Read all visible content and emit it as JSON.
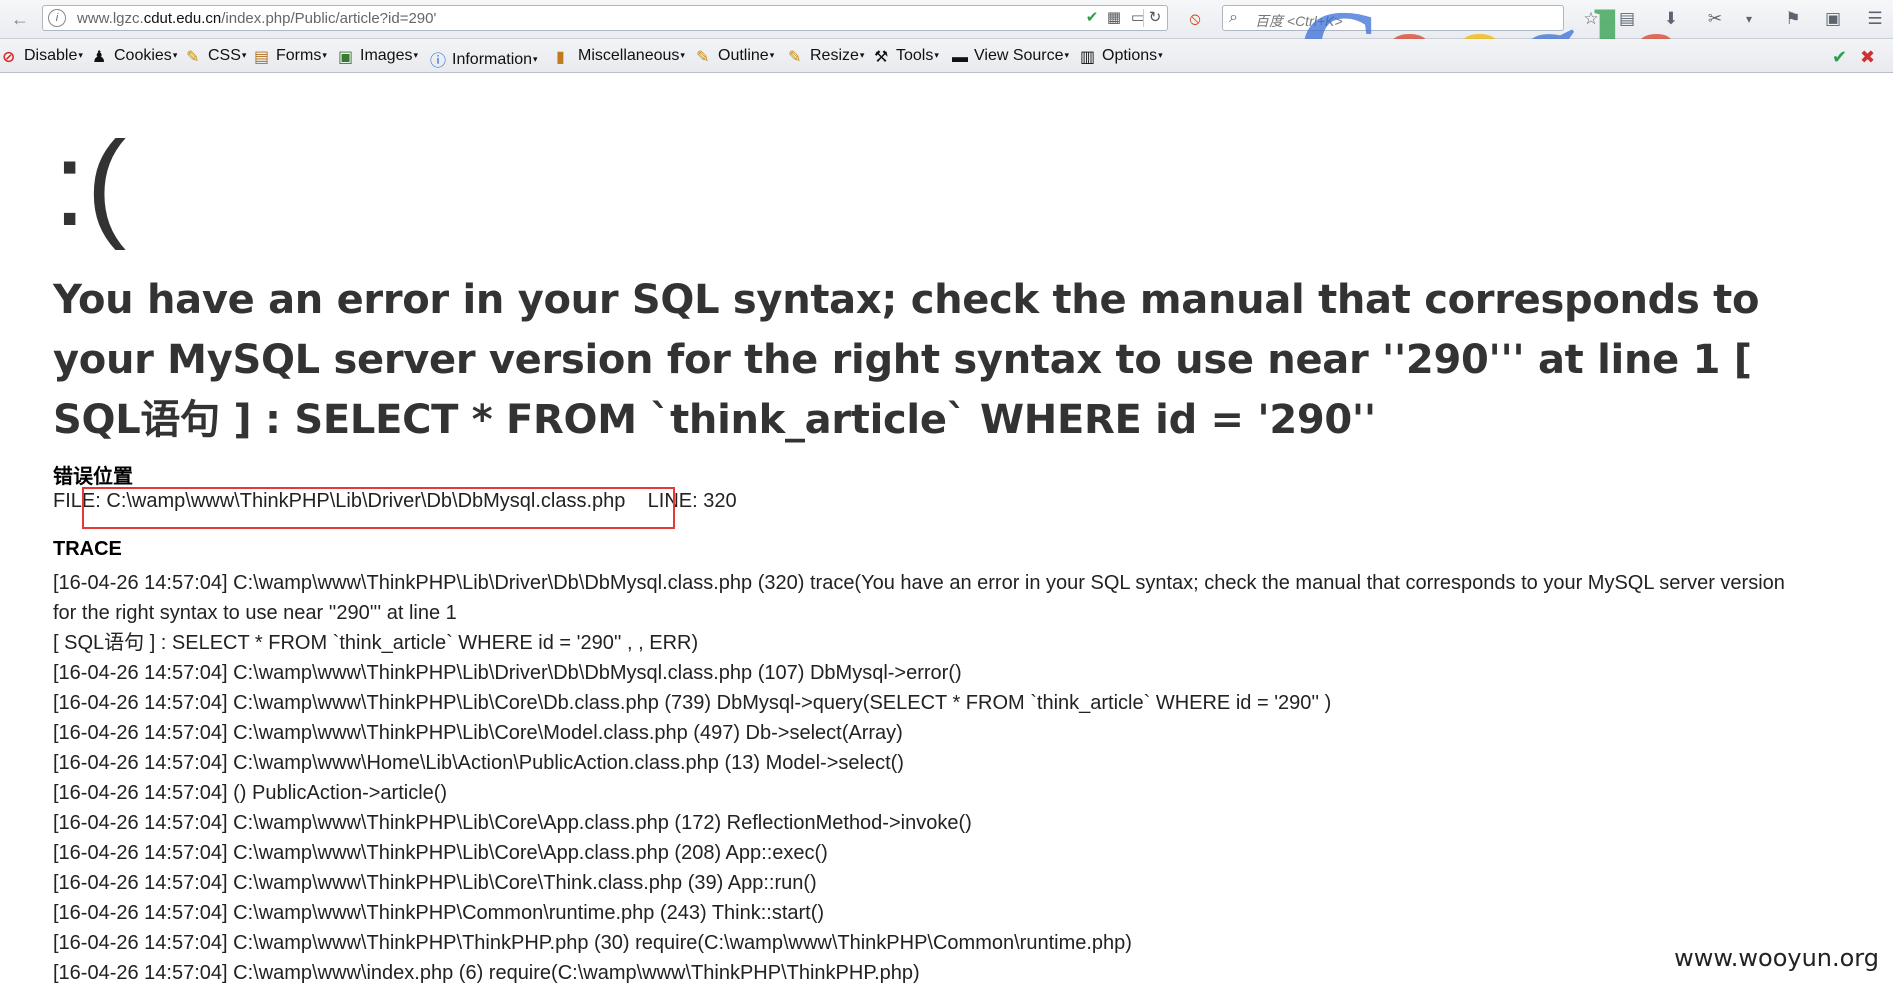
{
  "browser": {
    "url_prefix": "www.lgzc.",
    "url_domain": "cdut.edu.cn",
    "url_path": "/index.php/Public/article?id=290'",
    "search_placeholder": "百度 <Ctrl+K>"
  },
  "devbar": {
    "items": [
      "Disable",
      "Cookies",
      "CSS",
      "Forms",
      "Images",
      "Information",
      "Miscellaneous",
      "Outline",
      "Resize",
      "Tools",
      "View Source",
      "Options"
    ]
  },
  "error": {
    "face": ":(",
    "message": "You have an error in your SQL syntax; check the manual that corresponds to your MySQL server version for the right syntax to use near ''290''' at line 1 [ SQL语句 ] : SELECT * FROM `think_article` WHERE id = '290''",
    "location_title": "错误位置",
    "file_label": "FILE",
    "file_path": "C:\\wamp\\www\\ThinkPHP\\Lib\\Driver\\Db\\DbMysql.class.php",
    "line_label": "LINE: 320",
    "trace_title": "TRACE",
    "trace": [
      "[16-04-26 14:57:04] C:\\wamp\\www\\ThinkPHP\\Lib\\Driver\\Db\\DbMysql.class.php (320) trace(You have an error in your SQL syntax; check the manual that corresponds to your MySQL server version for the right syntax to use near ''290''' at line 1",
      "[ SQL语句 ] : SELECT * FROM `think_article` WHERE id = '290'' , , ERR)",
      "[16-04-26 14:57:04] C:\\wamp\\www\\ThinkPHP\\Lib\\Driver\\Db\\DbMysql.class.php (107) DbMysql->error()",
      "[16-04-26 14:57:04] C:\\wamp\\www\\ThinkPHP\\Lib\\Core\\Db.class.php (739) DbMysql->query(SELECT * FROM `think_article` WHERE id = '290'' )",
      "[16-04-26 14:57:04] C:\\wamp\\www\\ThinkPHP\\Lib\\Core\\Model.class.php (497) Db->select(Array)",
      "[16-04-26 14:57:04] C:\\wamp\\www\\Home\\Lib\\Action\\PublicAction.class.php (13) Model->select()",
      "[16-04-26 14:57:04] () PublicAction->article()",
      "[16-04-26 14:57:04] C:\\wamp\\www\\ThinkPHP\\Lib\\Core\\App.class.php (172) ReflectionMethod->invoke()",
      "[16-04-26 14:57:04] C:\\wamp\\www\\ThinkPHP\\Lib\\Core\\App.class.php (208) App::exec()",
      "[16-04-26 14:57:04] C:\\wamp\\www\\ThinkPHP\\Lib\\Core\\Think.class.php (39) App::run()",
      "[16-04-26 14:57:04] C:\\wamp\\www\\ThinkPHP\\Common\\runtime.php (243) Think::start()",
      "[16-04-26 14:57:04] C:\\wamp\\www\\ThinkPHP\\ThinkPHP.php (30) require(C:\\wamp\\www\\ThinkPHP\\Common\\runtime.php)",
      "[16-04-26 14:57:04] C:\\wamp\\www\\index.php (6) require(C:\\wamp\\www\\ThinkPHP\\ThinkPHP.php)"
    ]
  },
  "watermark": "www.wooyun.org",
  "colors": {
    "highlight_box": "#e53935",
    "text": "#333333"
  }
}
